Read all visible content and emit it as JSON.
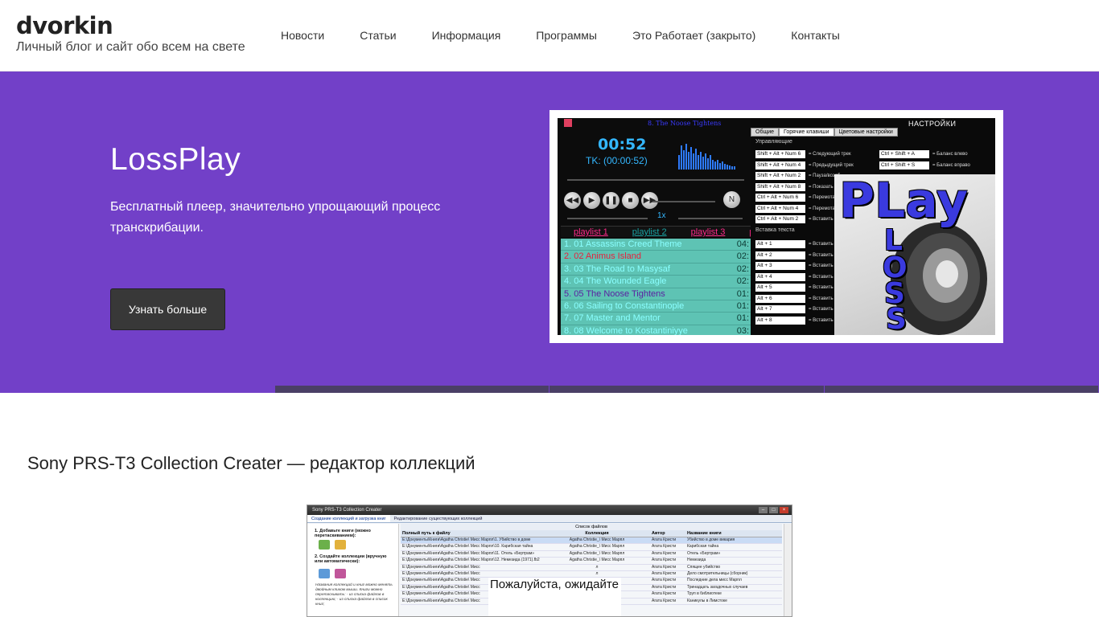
{
  "header": {
    "brand_title": "dvorkin",
    "brand_subtitle": "Личный блог и сайт обо всем на свете",
    "nav": [
      "Новости",
      "Статьи",
      "Информация",
      "Программы",
      "Это Работает (закрыто)",
      "Контакты"
    ]
  },
  "hero": {
    "title": "LossPlay",
    "description": "Бесплатный плеер, значительно упрощающий процесс транскрибации.",
    "button_label": "Узнать больше",
    "background_color": "#7240c8",
    "slides_count": 3,
    "player": {
      "track_title": "8. The Noose Tightens",
      "time": "00:52",
      "tk": "TK: (00:00:52)",
      "speed": "1x",
      "playlist_tabs": [
        "playlist 1",
        "playlist 2",
        "playlist 3",
        "play"
      ],
      "tracks": [
        {
          "name": "1. 01 Assassins Creed Theme",
          "dur": "04:",
          "color": "#8affff"
        },
        {
          "name": "2. 02 Animus Island",
          "dur": "02:",
          "color": "#e8203c"
        },
        {
          "name": "3. 03 The Road to Masysaf",
          "dur": "02:",
          "color": "#8affff"
        },
        {
          "name": "4. 04 The Wounded Eagle",
          "dur": "02:",
          "color": "#8affff"
        },
        {
          "name": "5. 05 The Noose Tightens",
          "dur": "01:",
          "color": "#5a1fa0"
        },
        {
          "name": "6. 06 Sailing to Constantinople",
          "dur": "01:",
          "color": "#8affff"
        },
        {
          "name": "7. 07 Master and Mentor",
          "dur": "01:",
          "color": "#8affff"
        },
        {
          "name": "8. 08 Welcome to Kostantiniyye",
          "dur": "03:",
          "color": "#8affff"
        }
      ]
    },
    "settings": {
      "title": "НАСТРОЙКИ",
      "tabs": [
        "Общие",
        "Горячие клавиши",
        "Цветовые настройки"
      ],
      "group_control": "Управляющие",
      "group_insert": "Вставка текста",
      "hotkeys_left": [
        {
          "key": "Shift + Alt + Num 6",
          "action": "= Следующий трек"
        },
        {
          "key": "Shift + Alt + Num 4",
          "action": "= Предыдущий трек"
        },
        {
          "key": "Shift + Alt + Num 2",
          "action": "= Пауза/возоб"
        },
        {
          "key": "Shift + Alt + Num 8",
          "action": "= Показать"
        },
        {
          "key": "Ctrl + Alt + Num 6",
          "action": "= Перемотать"
        },
        {
          "key": "Ctrl + Alt + Num 4",
          "action": "= Перемотать"
        },
        {
          "key": "Ctrl + Alt + Num 2",
          "action": "= Вставить"
        }
      ],
      "hotkeys_right": [
        {
          "key": "Ctrl + Shift + A",
          "action": "= Баланс влево"
        },
        {
          "key": "Ctrl + Shift + S",
          "action": "= Баланс вправо"
        }
      ],
      "inserts": [
        {
          "key": "Alt + 1",
          "action": "= Вставить"
        },
        {
          "key": "Alt + 2",
          "action": "= Вставить"
        },
        {
          "key": "Alt + 3",
          "action": "= Вставить"
        },
        {
          "key": "Alt + 4",
          "action": "= Вставить"
        },
        {
          "key": "Alt + 5",
          "action": "= Вставить"
        },
        {
          "key": "Alt + 6",
          "action": "= Вставить"
        },
        {
          "key": "Alt + 7",
          "action": "= Вставить"
        },
        {
          "key": "Alt + 8",
          "action": "= Вставить"
        }
      ],
      "logo_top": "PLay",
      "logo_letters": [
        "L",
        "O",
        "S",
        "S"
      ]
    }
  },
  "article": {
    "title": "Sony PRS-T3 Collection Creater — редактор коллекций",
    "screenshot": {
      "window_title": "Sony PRS-T3 Collection Creater",
      "tabs": [
        "Создание коллекций и загрузка книг",
        "Редактирование существующих коллекций"
      ],
      "step1": "1. Добавьте книги (можно перетаскиванием):",
      "step2": "2. Создайте коллекции (вручную или автоматически):",
      "note": "Названия коллекций и книг можно менять двойным кликом мыши. Книги можно перетаскивать: - из списка файлов в коллекцию; - из списка файлов в список книг;",
      "table_caption": "Список файлов",
      "columns": [
        "Полный путь к файлу",
        "Коллекция",
        "Автор",
        "Название книги"
      ],
      "rows": [
        [
          "E:\\Документы\\Книги\\Agatha Christie\\ Мисс Марпл\\1. Убийство в доме",
          "Agatha Christie_\\ Мисс Марпл",
          "Агата Кристи",
          "Убийство в доме викария"
        ],
        [
          "E:\\Документы\\Книги\\Agatha Christie\\ Мисс Марпл\\10. Карибская тайна",
          "Agatha Christie_\\ Мисс Марпл",
          "Агата Кристи",
          "Карибская тайна"
        ],
        [
          "E:\\Документы\\Книги\\Agatha Christie\\ Мисс Марпл\\11. Отель «Бертрам»",
          "Agatha Christie_\\ Мисс Марпл",
          "Агата Кристи",
          "Отель «Бертрам»"
        ],
        [
          "E:\\Документы\\Книги\\Agatha Christie\\ Мисс Марпл\\12. Немезида (1971).fb2",
          "Agatha Christie_\\ Мисс Марпл",
          "Агата Кристи",
          "Немезида"
        ],
        [
          "E:\\Документы\\Книги\\Agatha Christie\\ Мисс",
          "л",
          "Агата Кристи",
          "Спящее убийство"
        ],
        [
          "E:\\Документы\\Книги\\Agatha Christie\\ Мисс",
          "л",
          "Агата Кристи",
          "Дело смотрительницы (сборник)"
        ],
        [
          "E:\\Документы\\Книги\\Agatha Christie\\ Мисс",
          "л",
          "Агата Кристи",
          "Последние дела мисс Марпл"
        ],
        [
          "E:\\Документы\\Книги\\Agatha Christie\\ Мисс",
          "л",
          "Агата Кристи",
          "Тринадцать загадочных случаев"
        ],
        [
          "E:\\Документы\\Книги\\Agatha Christie\\ Мисс",
          "л",
          "Агата Кристи",
          "Труп в библиотеке"
        ],
        [
          "E:\\Документы\\Книги\\Agatha Christie\\ Мисс",
          "л",
          "Агата Кристи",
          "Каникулы в Лимстоке"
        ]
      ],
      "wait_text": "Пожалуйста, ожидайте"
    }
  }
}
